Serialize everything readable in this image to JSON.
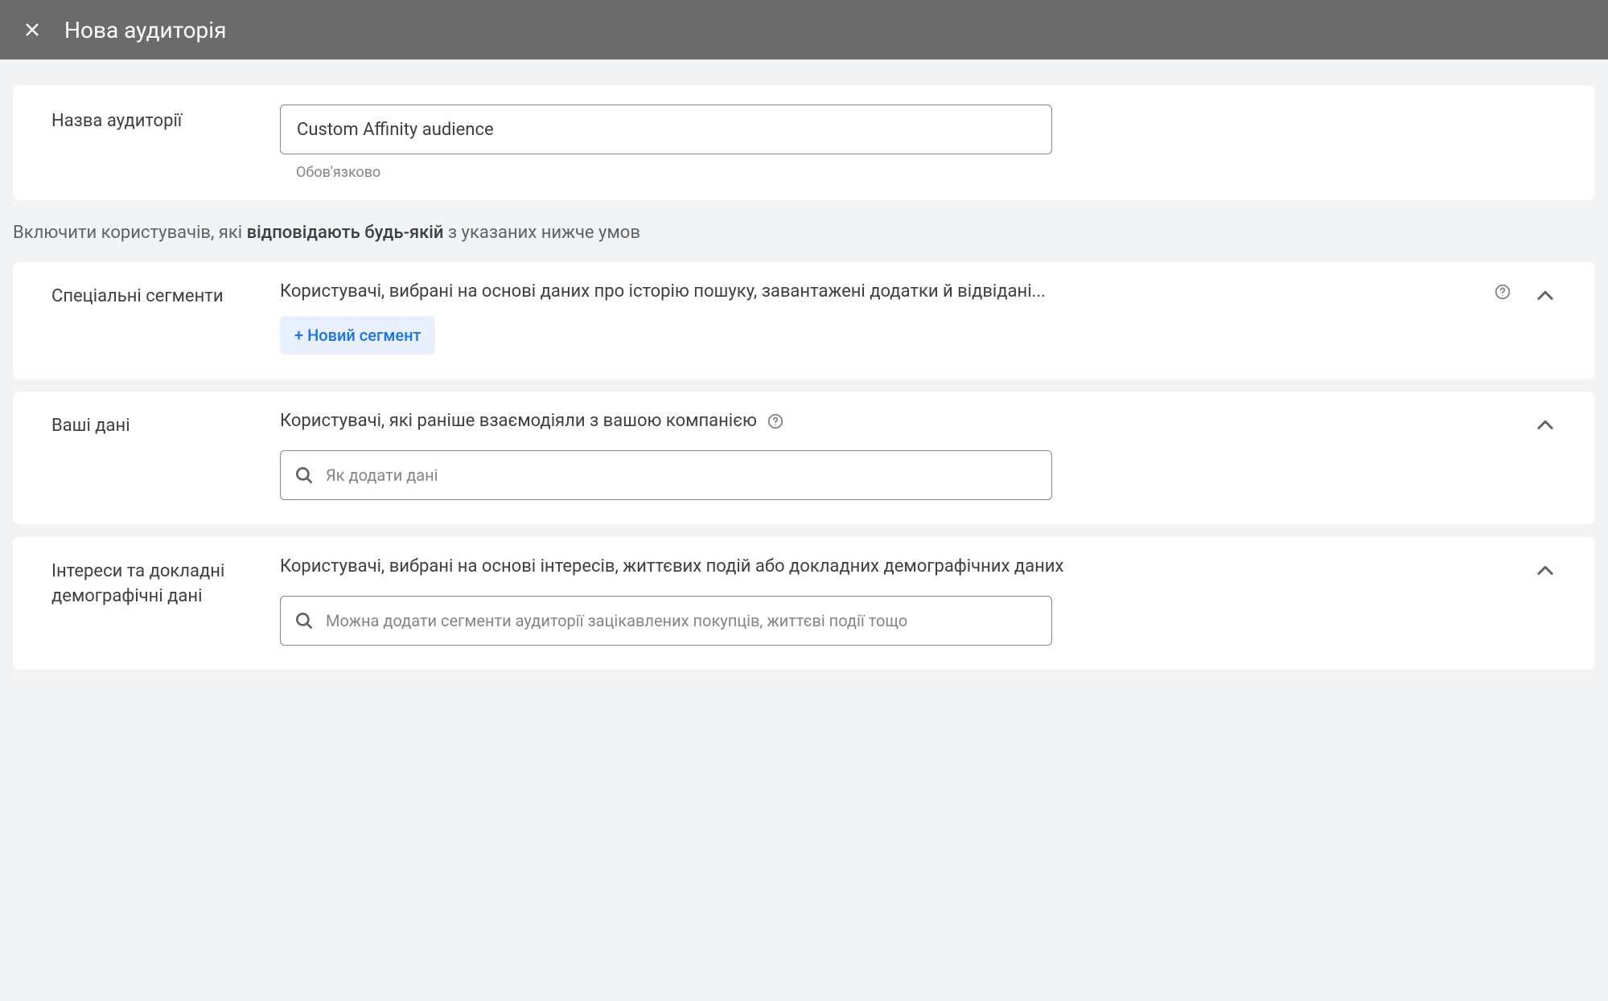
{
  "header": {
    "title": "Нова аудиторія"
  },
  "audience_name": {
    "label": "Назва аудиторії",
    "value": "Custom Affinity audience",
    "helper": "Обов'язково"
  },
  "intro": {
    "prefix": "Включити користувачів, які ",
    "bold": "відповідають будь-якій",
    "suffix": " з указаних нижче умов"
  },
  "sections": {
    "custom_segments": {
      "label": "Спеціальні сегменти",
      "description": "Користувачі, вибрані на основі даних про історію пошуку, завантажені додатки й відвідані...",
      "new_segment_button": "+ Новий сегмент"
    },
    "your_data": {
      "label": "Ваші дані",
      "description": "Користувачі, які раніше взаємодіяли з вашою компанією",
      "search_placeholder": "Як додати дані"
    },
    "interests": {
      "label": "Інтереси та докладні демографічні дані",
      "description": "Користувачі, вибрані на основі інтересів, життєвих подій або докладних демографічних даних",
      "search_placeholder": "Можна додати сегменти аудиторії зацікавлених покупців, життєві події тощо"
    }
  }
}
